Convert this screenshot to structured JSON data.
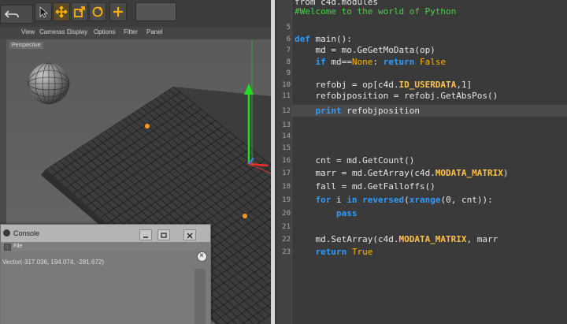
{
  "app3d": {
    "menus": [
      "View",
      "Cameras",
      "Display",
      "Options",
      "Filter",
      "Panel"
    ],
    "viewport_label": "Perspective",
    "toolbar_icons": [
      "cursor-icon",
      "move-icon",
      "scale-icon",
      "rotate-icon",
      "add-icon"
    ]
  },
  "console": {
    "title": "Console",
    "menu_file": "File",
    "output_line": "Vector(-317.036, 194.074, -281.672)"
  },
  "editor": {
    "lines": [
      {
        "n": "",
        "code": "from c4d.modules"
      },
      {
        "n": "",
        "code": "#Welcome to the world of Python"
      },
      {
        "n": "5",
        "code": ""
      },
      {
        "n": "6",
        "code": "def main():"
      },
      {
        "n": "7",
        "code": "    md = mo.GeGetMoData(op)"
      },
      {
        "n": "8",
        "code": "    if md==None: return False"
      },
      {
        "n": "9",
        "code": ""
      },
      {
        "n": "10",
        "code": "    refobj = op[c4d.ID_USERDATA,1]"
      },
      {
        "n": "11",
        "code": "    refobjposition = refobj.GetAbsPos()"
      },
      {
        "n": "12",
        "code": "    print refobjposition"
      },
      {
        "n": "13",
        "code": ""
      },
      {
        "n": "14",
        "code": ""
      },
      {
        "n": "15",
        "code": ""
      },
      {
        "n": "16",
        "code": "    cnt = md.GetCount()"
      },
      {
        "n": "17",
        "code": "    marr = md.GetArray(c4d.MODATA_MATRIX)"
      },
      {
        "n": "18",
        "code": "    fall = md.GetFalloffs()"
      },
      {
        "n": "19",
        "code": "    for i in reversed(xrange(0, cnt)):"
      },
      {
        "n": "20",
        "code": "        pass"
      },
      {
        "n": "21",
        "code": ""
      },
      {
        "n": "22",
        "code": "    md.SetArray(c4d.MODATA_MATRIX, marr"
      },
      {
        "n": "23",
        "code": "    return True"
      }
    ]
  },
  "colors": {
    "keyword": "#2f9cff",
    "constant": "#ffc14d",
    "comment": "#46d246",
    "editor_bg": "#3a3a3a",
    "viewport_bg": "#5e5e5e",
    "y_axis": "#22dd22",
    "x_axis": "#ff2a2a",
    "z_axis": "#4a6cff"
  }
}
